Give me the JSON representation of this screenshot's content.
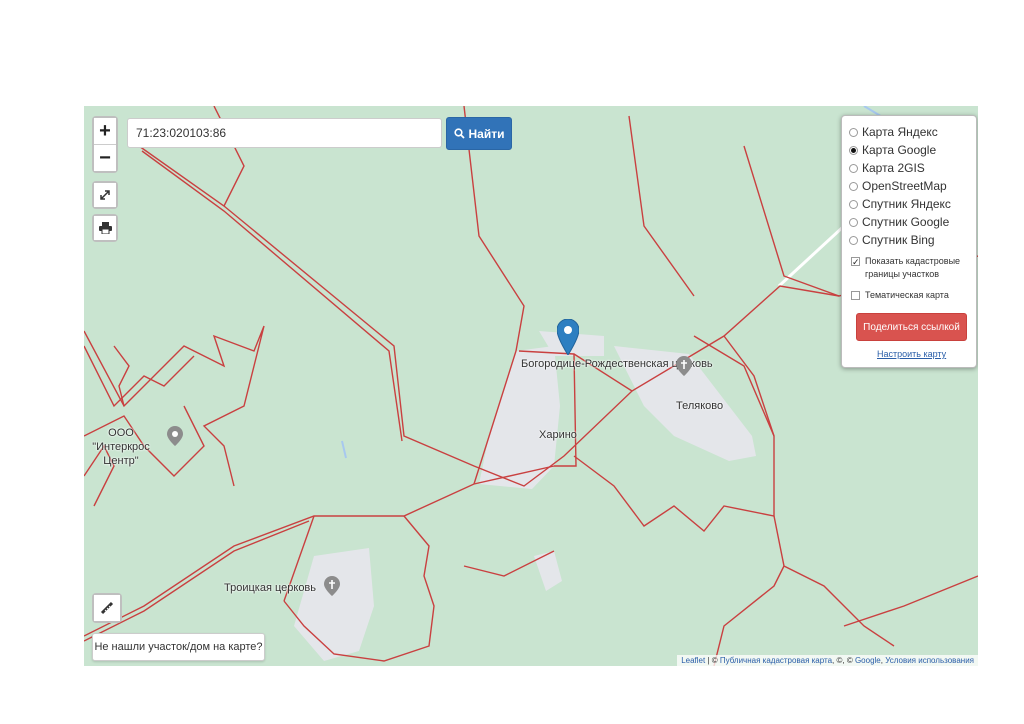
{
  "search": {
    "value": "71:23:020103:86",
    "button_label": "Найти"
  },
  "zoom": {
    "in": "+",
    "out": "−"
  },
  "layers": {
    "options": [
      {
        "label": "Карта Яндекс",
        "selected": false
      },
      {
        "label": "Карта Google",
        "selected": true
      },
      {
        "label": "Карта 2GIS",
        "selected": false
      },
      {
        "label": "OpenStreetMap",
        "selected": false
      },
      {
        "label": "Спутник Яндекс",
        "selected": false
      },
      {
        "label": "Спутник Google",
        "selected": false
      },
      {
        "label": "Спутник Bing",
        "selected": false
      }
    ],
    "show_cadastral": {
      "label": "Показать кадастровые границы участков",
      "checked": true
    },
    "thematic": {
      "label": "Тематическая карта",
      "checked": false
    },
    "share_label": "Поделиться ссылкой",
    "configure_label": "Настроить карту"
  },
  "places": {
    "church1": "Богородице-Рождественская церковь",
    "village1": "Харино",
    "village2": "Теляково",
    "company": "ООО \"Интеркрос Центр\"",
    "church2": "Троицкая церковь"
  },
  "not_found_label": "Не нашли участок/дом на карте?",
  "attribution": {
    "leaflet": "Leaflet",
    "sep": " | © ",
    "pkk": "Публичная кадастровая карта",
    "mid": ", ©, © ",
    "google": "Google",
    "terms": "Условия использования"
  },
  "colors": {
    "map_bg": "#c9e4d0",
    "boundary": "#c94040",
    "settlement": "#e4e6ea",
    "marker": "#2d7fc1",
    "search_button": "#3173b8",
    "share_button": "#d9534f"
  },
  "icons": {
    "fullscreen": "fullscreen-icon",
    "print": "printer-icon",
    "ruler": "ruler-icon",
    "search": "search-icon",
    "marker": "map-marker-icon",
    "place": "place-pin-icon"
  }
}
